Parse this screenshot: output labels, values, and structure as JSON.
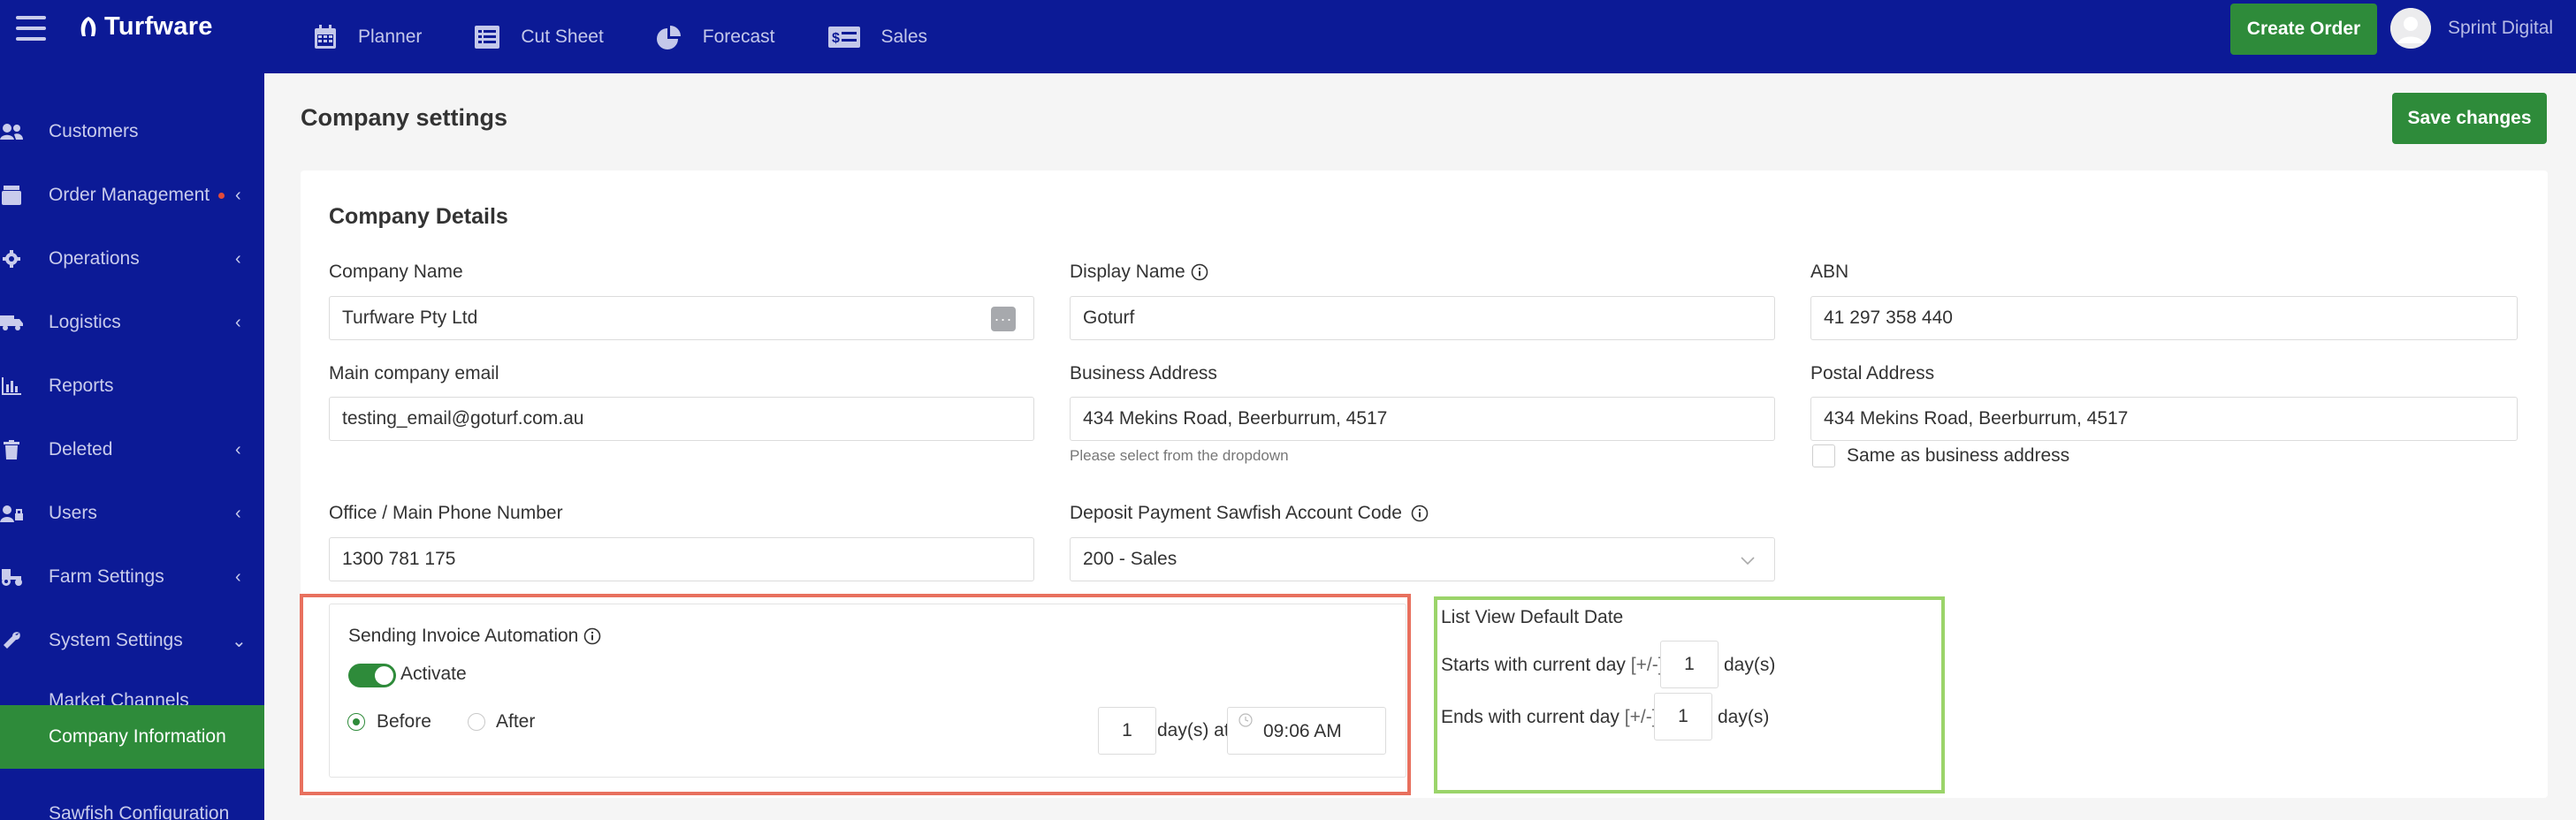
{
  "app": {
    "brand": "Turfware",
    "nav": [
      {
        "label": "Planner",
        "icon": "calendar-icon"
      },
      {
        "label": "Cut Sheet",
        "icon": "cut-sheet-icon"
      },
      {
        "label": "Forecast",
        "icon": "pie-chart-icon"
      },
      {
        "label": "Sales",
        "icon": "dollar-sheet-icon"
      }
    ],
    "create_order_label": "Create Order",
    "user_name": "Sprint Digital"
  },
  "sidebar": {
    "items": [
      {
        "label": "Customers",
        "icon": "users-icon"
      },
      {
        "label": "Order Management",
        "icon": "box-icon"
      },
      {
        "label": "Operations",
        "icon": "gear-icon"
      },
      {
        "label": "Logistics",
        "icon": "truck-icon"
      },
      {
        "label": "Reports",
        "icon": "bar-chart-icon"
      },
      {
        "label": "Deleted",
        "icon": "trash-icon"
      },
      {
        "label": "Users",
        "icon": "user-lock-icon"
      },
      {
        "label": "Farm Settings",
        "icon": "tractor-icon"
      },
      {
        "label": "System Settings",
        "icon": "wrench-icon"
      },
      {
        "label": "Market Channels"
      },
      {
        "label": "Company Information"
      },
      {
        "label": "Sawfish Configuration"
      }
    ],
    "active": "Company Information",
    "colors": {
      "background": "#0c1a96",
      "active": "#2e8b3a",
      "notification_dot": "#e24b3a"
    }
  },
  "page": {
    "title": "Company settings",
    "save_label": "Save changes"
  },
  "company_details": {
    "heading": "Company Details",
    "company_name": {
      "label": "Company Name",
      "value": "Turfware Pty Ltd"
    },
    "display_name": {
      "label": "Display Name",
      "value": "Goturf"
    },
    "abn": {
      "label": "ABN",
      "value": "41 297 358 440"
    },
    "email": {
      "label": "Main company email",
      "value": "testing_email@goturf.com.au"
    },
    "business_address": {
      "label": "Business Address",
      "value": "434 Mekins Road, Beerburrum, 4517",
      "hint": "Please select from the dropdown"
    },
    "postal_address": {
      "label": "Postal Address",
      "value": "434 Mekins Road, Beerburrum, 4517",
      "same_as_label": "Same as business address",
      "same_as_checked": false
    },
    "phone": {
      "label": "Office / Main Phone Number",
      "value": "1300 781 175"
    },
    "deposit_account": {
      "label": "Deposit Payment Sawfish Account Code",
      "value": "200 - Sales"
    }
  },
  "invoice_automation": {
    "title": "Sending Invoice Automation",
    "activate_label": "Activate",
    "activate_on": true,
    "before_label": "Before",
    "after_label": "After",
    "selected": "Before",
    "days": "1",
    "days_suffix": "day(s) at",
    "time": "09:06 AM"
  },
  "list_view": {
    "title": "List View Default Date",
    "starts_label": "Starts with current day",
    "ends_label": "Ends with current day",
    "pm": "[+/-]",
    "starts_value": "1",
    "ends_value": "1",
    "unit": "day(s)"
  },
  "highlight_colors": {
    "red": "#e8705e",
    "green": "#9bd46a"
  }
}
